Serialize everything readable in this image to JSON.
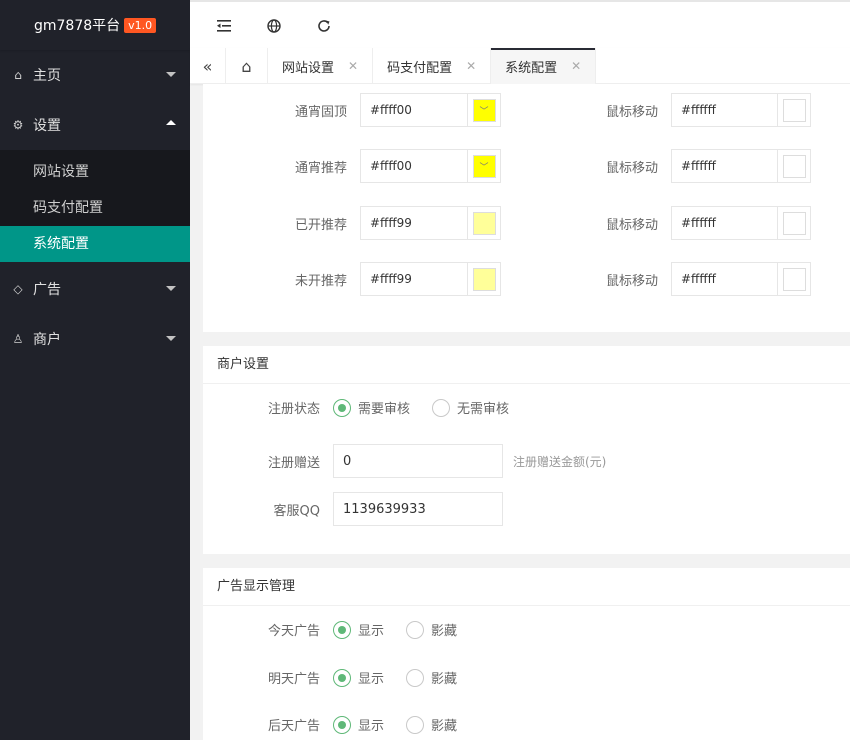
{
  "app": {
    "name": "gm7878平台",
    "version": "v1.0"
  },
  "sidebar": {
    "items": [
      {
        "label": "主页",
        "icon": "home-icon"
      },
      {
        "label": "设置",
        "icon": "gear-icon"
      },
      {
        "label": "广告",
        "icon": "diamond-icon"
      },
      {
        "label": "商户",
        "icon": "user-icon"
      }
    ],
    "sub": [
      {
        "label": "网站设置"
      },
      {
        "label": "码支付配置"
      },
      {
        "label": "系统配置"
      }
    ]
  },
  "header": {
    "icons": [
      "menu-fold-icon",
      "globe-icon",
      "refresh-icon"
    ]
  },
  "tabs": [
    {
      "label": "网站设置"
    },
    {
      "label": "码支付配置"
    },
    {
      "label": "系统配置"
    }
  ],
  "colors": {
    "rows": [
      {
        "label": "通宵固顶",
        "value": "#ffff00",
        "swatch": "#ffff00",
        "hover_label": "鼠标移动",
        "hover_value": "#ffffff"
      },
      {
        "label": "通宵推荐",
        "value": "#ffff00",
        "swatch": "#ffff00",
        "hover_label": "鼠标移动",
        "hover_value": "#ffffff"
      },
      {
        "label": "已开推荐",
        "value": "#ffff99",
        "swatch": "#ffff99",
        "hover_label": "鼠标移动",
        "hover_value": "#ffffff"
      },
      {
        "label": "未开推荐",
        "value": "#ffff99",
        "swatch": "#ffff99",
        "hover_label": "鼠标移动",
        "hover_value": "#ffffff"
      }
    ]
  },
  "merchant": {
    "title": "商户设置",
    "reg_status_label": "注册状态",
    "reg_options": [
      "需要审核",
      "无需审核"
    ],
    "gift_label": "注册赠送",
    "gift_value": "0",
    "gift_hint": "注册赠送金额(元)",
    "qq_label": "客服QQ",
    "qq_value": "1139639933"
  },
  "ads": {
    "title": "广告显示管理",
    "rows": [
      {
        "label": "今天广告",
        "options": [
          "显示",
          "影藏"
        ]
      },
      {
        "label": "明天广告",
        "options": [
          "显示",
          "影藏"
        ]
      },
      {
        "label": "后天广告",
        "options": [
          "显示",
          "影藏"
        ]
      }
    ]
  }
}
